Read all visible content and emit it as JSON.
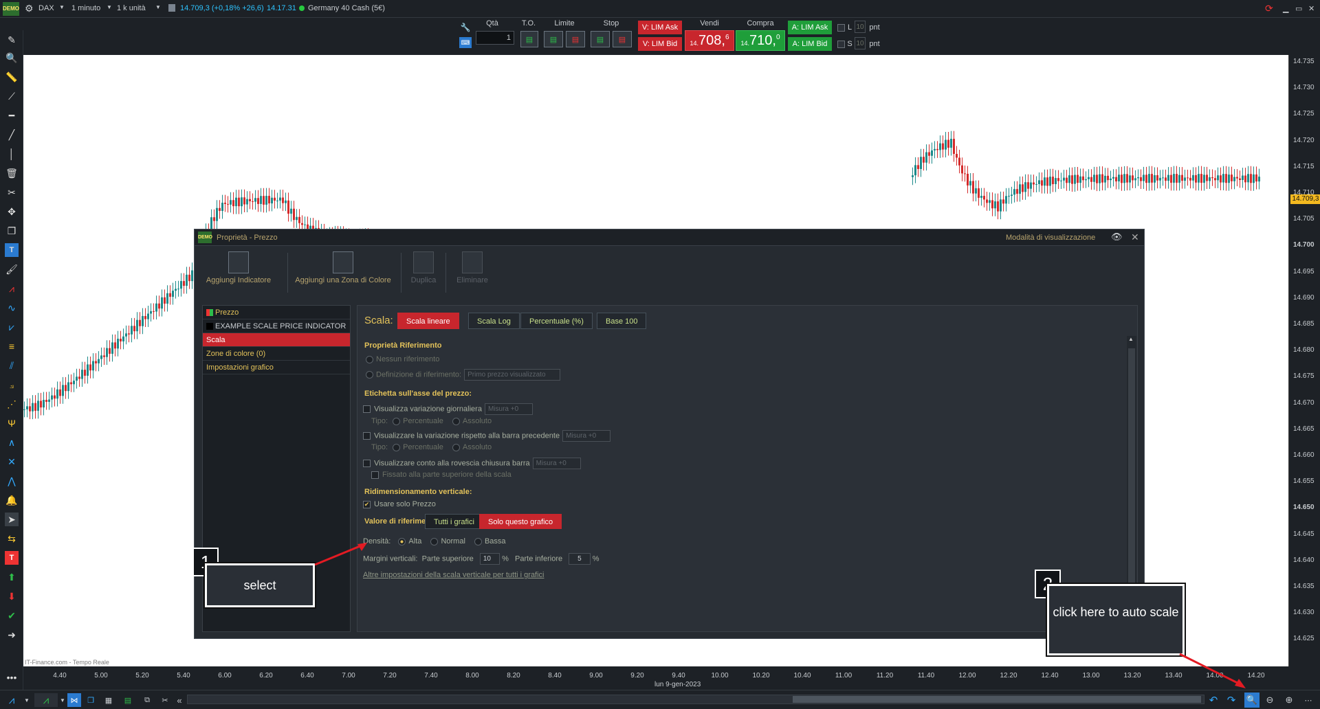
{
  "topbar": {
    "symbol": "DAX",
    "timeframe": "1 minuto",
    "units": "1 k unità",
    "quote": "14.709,3 (+0,18% +26,6)",
    "time": "14.17.31",
    "instrument": "Germany 40 Cash (5€)",
    "demo": "DEMO"
  },
  "trade": {
    "qty_label": "Qtà",
    "qty_value": "1",
    "to_label": "T.O.",
    "limit_label": "Limite",
    "stop_label": "Stop",
    "v_lim_ask": "V: LIM Ask",
    "v_lim_bid": "V: LIM Bid",
    "sell_label": "Vendi",
    "sell_prefix": "14.",
    "sell_price": "708,",
    "sell_sup": "6",
    "buy_label": "Compra",
    "buy_prefix": "14.",
    "buy_price": "710,",
    "buy_sup": "0",
    "a_lim_ask": "A: LIM Ask",
    "a_lim_bid": "A: LIM Bid",
    "l_label": "L",
    "s_label": "S",
    "l_value": "10",
    "s_value": "10",
    "pnt": "pnt"
  },
  "price_scale": [
    "14.735",
    "14.730",
    "14.725",
    "14.720",
    "14.715",
    "14.710",
    "14.705",
    "14.700",
    "14.695",
    "14.690",
    "14.685",
    "14.680",
    "14.675",
    "14.670",
    "14.665",
    "14.660",
    "14.655",
    "14.650",
    "14.645",
    "14.640",
    "14.635",
    "14.630",
    "14.625"
  ],
  "current_price": "14.709,3",
  "time_scale": [
    "4.40",
    "5.00",
    "5.20",
    "5.40",
    "6.00",
    "6.20",
    "6.40",
    "7.00",
    "7.20",
    "7.40",
    "8.00",
    "8.20",
    "8.40",
    "9.00",
    "9.20",
    "9.40",
    "10.00",
    "10.20",
    "10.40",
    "11.00",
    "11.20",
    "11.40",
    "12.00",
    "12.20",
    "12.40",
    "13.00",
    "13.20",
    "13.40",
    "14.00",
    "14.20"
  ],
  "date_label": "lun 9-gen-2023",
  "source": "IT-Finance.com - Tempo Reale",
  "dialog": {
    "title": "Proprietà - Prezzo",
    "mode": "Modalità di visualizzazione",
    "toolbar": [
      "Aggiungi Indicatore",
      "Aggiungi una Zona di Colore",
      "Duplica",
      "Eliminare"
    ],
    "left_items": [
      "Prezzo",
      "EXAMPLE SCALE PRICE INDICATOR",
      "Scala",
      "Zone di colore (0)",
      "Impostazioni grafico"
    ],
    "scale_label": "Scala:",
    "tabs": [
      "Scala lineare",
      "Scala Log",
      "Percentuale (%)",
      "Base 100"
    ],
    "ref_section": "Proprietà Riferimento",
    "ref_none": "Nessun riferimento",
    "ref_def": "Definizione di riferimento:",
    "ref_def_value": "Primo prezzo visualizzato",
    "label_section": "Etichetta sull'asse del prezzo:",
    "daily_var": "Visualizza variazione giornaliera",
    "measure": "Misura +0",
    "tipo": "Tipo:",
    "percentuale": "Percentuale",
    "assoluto": "Assoluto",
    "prev_var": "Visualizzare la variazione rispetto alla barra precedente",
    "countdown": "Visualizzare conto alla rovescia chiusura barra",
    "fixed_top": "Fissato alla parte superiore della scala",
    "vert_section": "Ridimensionamento verticale:",
    "use_price_only": "Usare solo Prezzo",
    "ref_value_label": "Valore di riferimento:",
    "all_charts": "Tutti i grafici",
    "this_chart": "Solo questo grafico",
    "density_label": "Densità:",
    "density": [
      "Alta",
      "Normal",
      "Bassa"
    ],
    "margins_label": "Margini verticali:",
    "top_label": "Parte superiore",
    "top_value": "10",
    "bottom_label": "Parte inferiore",
    "bottom_value": "5",
    "pct": "%",
    "other_link": "Altre impostazioni della scala verticale per tutti i grafici"
  },
  "callouts": {
    "one_num": "1",
    "one_text": "select",
    "two_num": "2",
    "two_text": "click here to auto scale"
  },
  "colors": {
    "red": "#c8262d",
    "green": "#1f9e3a",
    "accent": "#e3c25a"
  }
}
